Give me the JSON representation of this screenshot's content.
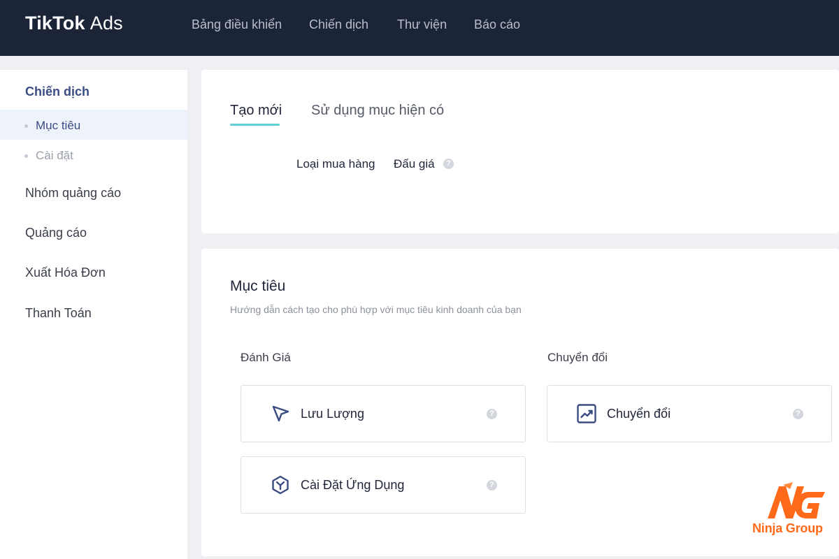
{
  "brand": {
    "name_bold": "TikTok",
    "name_light": "Ads"
  },
  "nav": [
    {
      "label": "Bảng điều khiển"
    },
    {
      "label": "Chiến dịch"
    },
    {
      "label": "Thư viện"
    },
    {
      "label": "Báo cáo"
    }
  ],
  "sidebar": {
    "heading": "Chiến dịch",
    "sub_items": [
      {
        "label": "Mục tiêu",
        "active": true
      },
      {
        "label": "Cài đặt",
        "active": false
      }
    ],
    "items": [
      {
        "label": "Nhóm quảng cáo"
      },
      {
        "label": "Quảng cáo"
      },
      {
        "label": "Xuất Hóa Đơn"
      },
      {
        "label": "Thanh Toán"
      }
    ]
  },
  "tabs": {
    "create_new": "Tạo mới",
    "use_existing": "Sử dụng mục hiện có"
  },
  "buying_type": {
    "label": "Loại mua hàng",
    "value": "Đấu giá"
  },
  "objective": {
    "title": "Mục tiêu",
    "subtitle": "Hướng dẫn cách tạo cho phù hợp với mục tiêu kinh doanh của bạn",
    "groups": [
      {
        "label": "Đánh Giá",
        "options": [
          {
            "label": "Lưu Lượng",
            "icon": "cursor-arrow-icon"
          },
          {
            "label": "Cài Đặt Ứng Dụng",
            "icon": "app-install-icon"
          }
        ]
      },
      {
        "label": "Chuyển đổi",
        "options": [
          {
            "label": "Chuyển đổi",
            "icon": "conversion-chart-icon"
          }
        ]
      }
    ]
  },
  "watermark": {
    "text": "Ninja Group"
  },
  "colors": {
    "topbar": "#1c2438",
    "accent_teal": "#65cfd6",
    "sidebar_active": "#3b4c82",
    "icon_blue": "#3b4c82",
    "logo_orange": "#ff6a1a"
  }
}
